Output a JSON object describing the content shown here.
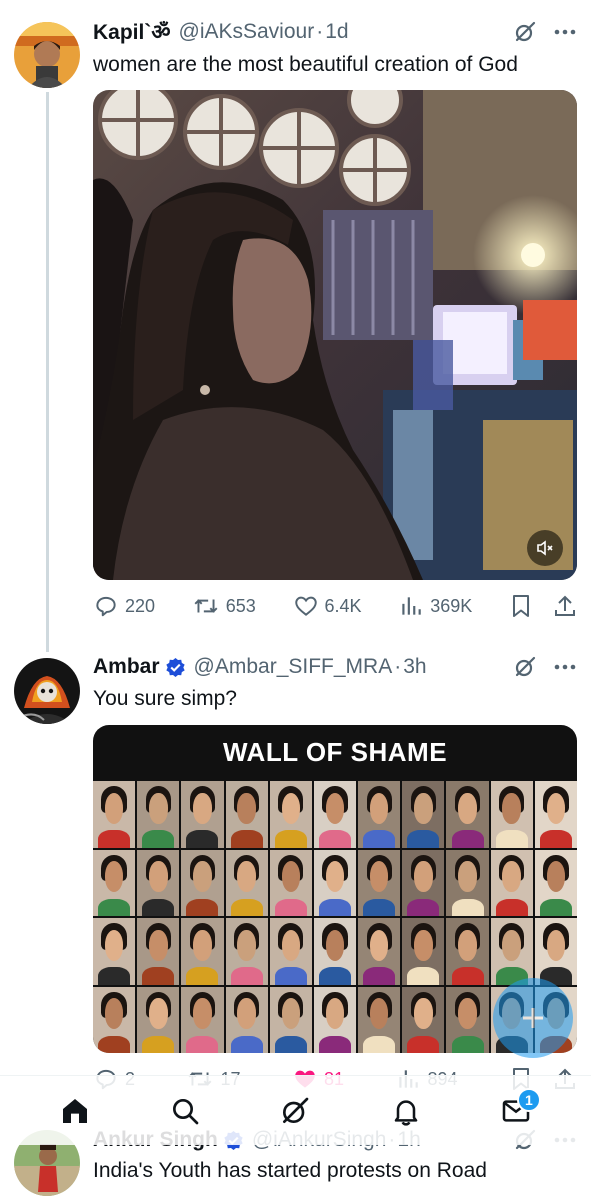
{
  "tweets": [
    {
      "name": "Kapil`ॐ",
      "handle": "@iAKsSaviour",
      "time": "1d",
      "text": "women are the most beautiful creation of God",
      "stats": {
        "replies": "220",
        "reposts": "653",
        "likes": "6.4K",
        "views": "369K"
      }
    },
    {
      "name": "Ambar",
      "handle": "@Ambar_SIFF_MRA",
      "time": "3h",
      "text": "You sure simp?",
      "media_title": "WALL OF SHAME",
      "stats": {
        "replies": "2",
        "reposts": "17",
        "likes": "81",
        "views": "894"
      }
    },
    {
      "name": "Ankur Singh",
      "handle": "@iAnkurSingh",
      "time": "1h",
      "text": "India's Youth has started protests on Road"
    }
  ],
  "nav": {
    "notification_count": "1"
  },
  "colors": {
    "accent": "#1d9bf0",
    "like": "#f91880",
    "muted": "#536471",
    "verified": "#1d4ed8"
  }
}
